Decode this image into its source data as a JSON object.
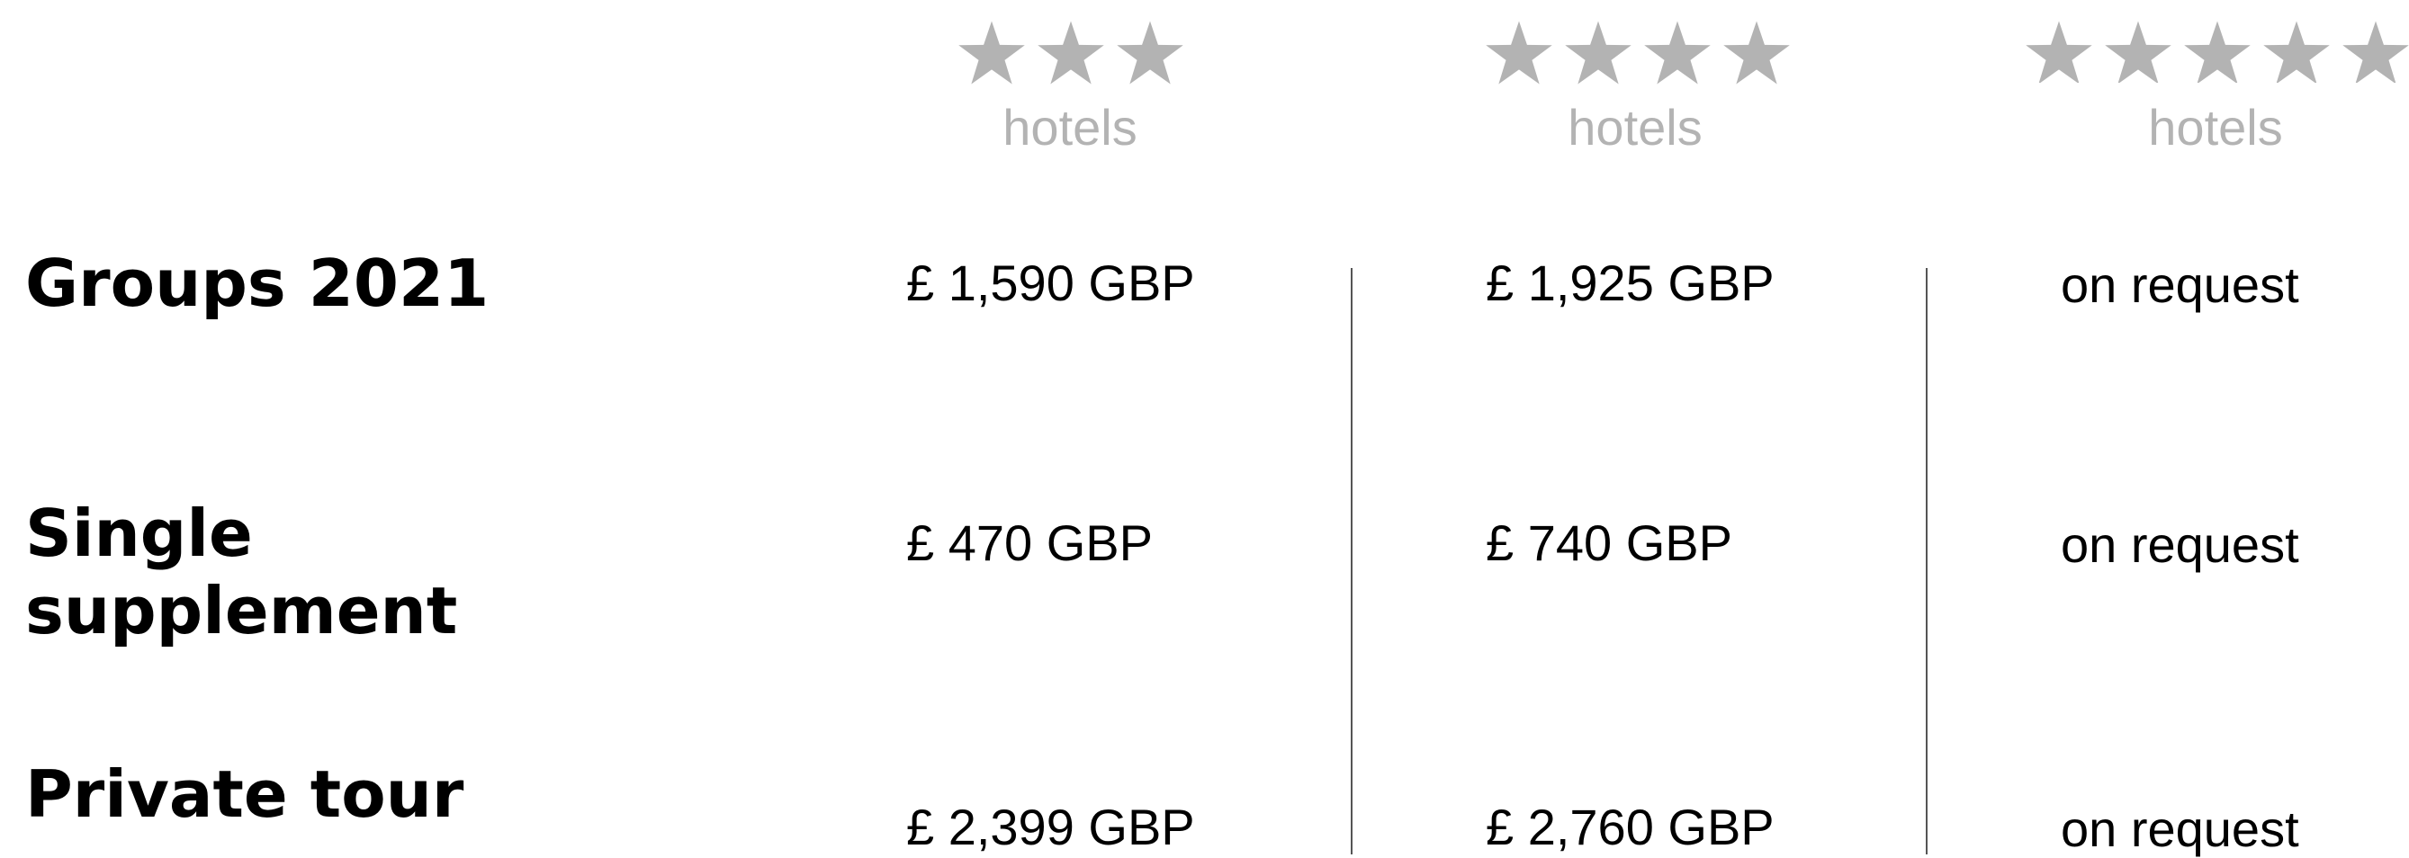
{
  "header": {
    "categories": [
      {
        "stars": 3,
        "label": "hotels"
      },
      {
        "stars": 4,
        "label": "hotels"
      },
      {
        "stars": 5,
        "label": "hotels"
      }
    ]
  },
  "colors": {
    "star": "#b3b3b3",
    "label_gray": "#b3b3b3",
    "text": "#000000",
    "divider": "#555555"
  },
  "rows": [
    {
      "label": "Groups 2021",
      "values": [
        "£ 1,590 GBP",
        "£ 1,925 GBP",
        "on request"
      ]
    },
    {
      "label_line1": "Single",
      "label_line2": "supplement",
      "values": [
        "£ 470 GBP",
        "£ 740 GBP",
        "on request"
      ]
    },
    {
      "label": "Private tour",
      "values": [
        "£ 2,399 GBP",
        "£ 2,760 GBP",
        "on request"
      ]
    }
  ]
}
